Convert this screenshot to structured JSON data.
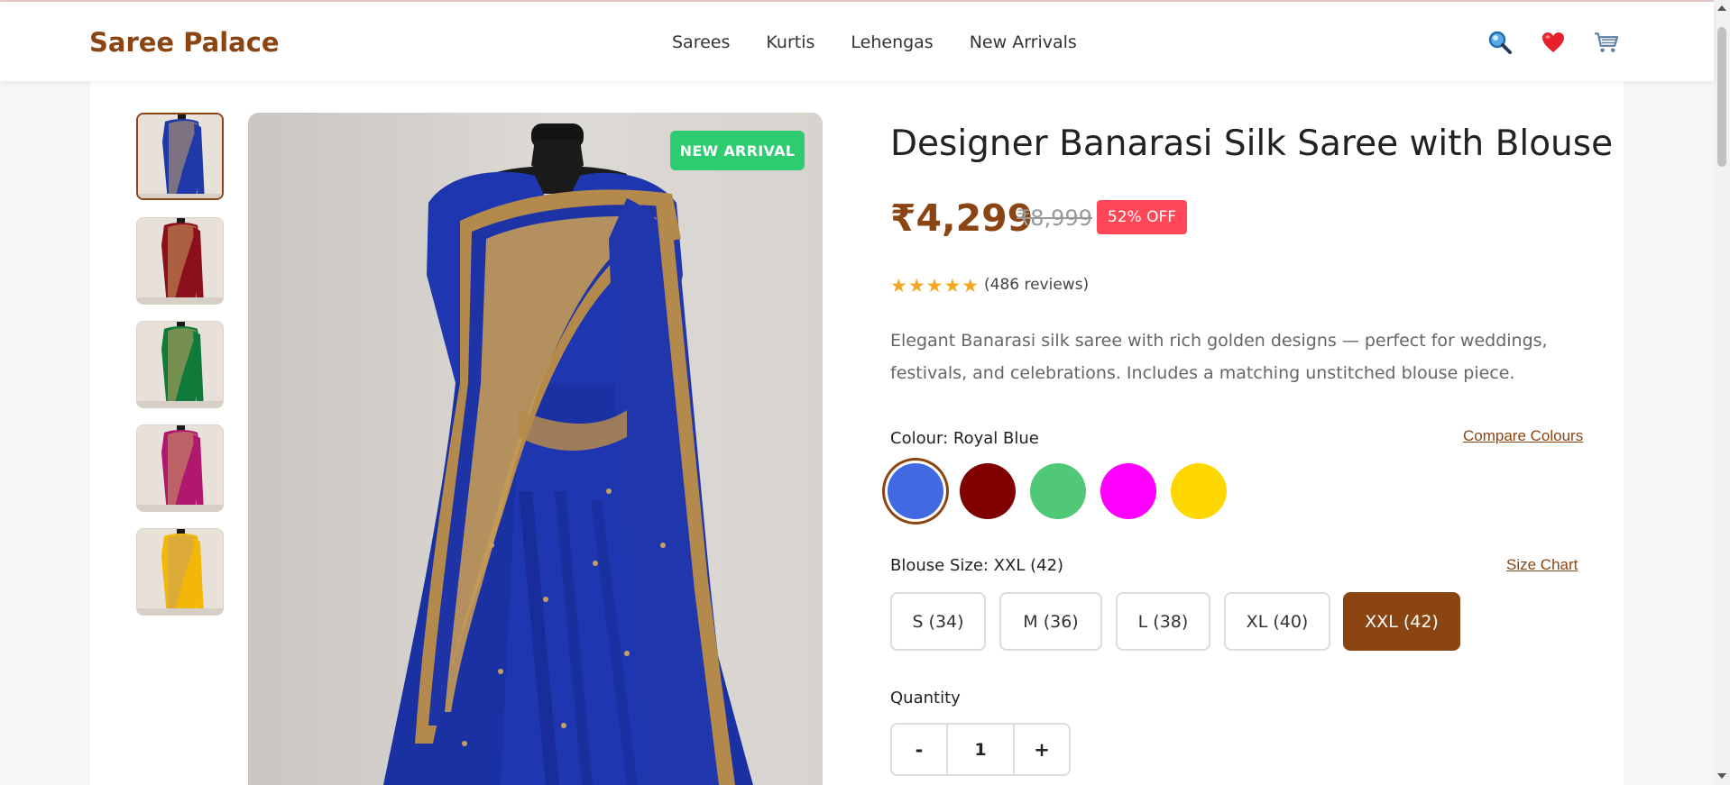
{
  "brand": {
    "name": "Saree Palace"
  },
  "nav": [
    "Sarees",
    "Kurtis",
    "Lehengas",
    "New Arrivals"
  ],
  "header_icons": [
    "search-icon",
    "heart-icon",
    "cart-icon"
  ],
  "gallery": {
    "thumbnails": [
      {
        "color": "#1f3aa8",
        "active": true
      },
      {
        "color": "#8b0f1c",
        "active": false
      },
      {
        "color": "#0f7a3a",
        "active": false
      },
      {
        "color": "#b0186e",
        "active": false
      },
      {
        "color": "#f2b707",
        "active": false
      }
    ],
    "badge": "NEW ARRIVAL"
  },
  "product": {
    "title": "Designer Banarasi Silk Saree with Blouse",
    "price": "₹4,299",
    "mrp": "₹8,999",
    "discount": "52% OFF",
    "rating": {
      "stars": "★★★★★",
      "value": 5,
      "reviews": "(486 reviews)"
    },
    "description": "Elegant Banarasi silk saree with rich golden designs — perfect for weddings, festivals, and celebrations. Includes a matching unstitched blouse piece."
  },
  "colour": {
    "label": "Colour: Royal Blue",
    "compare_link": "Compare Colours",
    "options": [
      "#4169e1",
      "#800000",
      "#50c878",
      "#ff00ff",
      "#ffd700"
    ],
    "selected_index": 0
  },
  "blouse_size": {
    "label": "Blouse Size: XXL (42)",
    "chart_link": "Size Chart",
    "options": [
      "S (34)",
      "M (36)",
      "L (38)",
      "XL (40)",
      "XXL (42)"
    ],
    "selected_index": 4
  },
  "quantity": {
    "label": "Quantity",
    "minus": "-",
    "value": "1",
    "plus": "+"
  },
  "colors": {
    "accent": "#8b4513",
    "badge_green": "#2ecc71",
    "discount_red": "#ff4757",
    "star": "#f5a623"
  }
}
